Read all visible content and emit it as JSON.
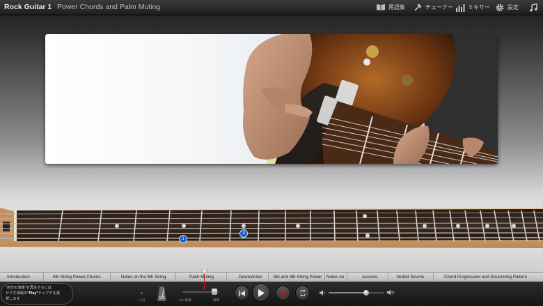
{
  "app": {
    "title": "Rock Guitar 1",
    "lesson": "Power Chords and Palm Muting"
  },
  "toolbar": {
    "glossary": "用語集",
    "tuner": "チューナー",
    "mixer": "ミキサー",
    "settings": "設定"
  },
  "chapters": [
    "Introduction",
    "6th String Power Chords",
    "Notes on the 6th String",
    "Palm Muting",
    "Downstroke",
    "5th and 4th String Power",
    "Notes on",
    "Accents",
    "Muted Strums",
    "Chord Progression and Strumming Pattern"
  ],
  "fretboard": {
    "finger_markers": [
      "1",
      "3"
    ]
  },
  "hint": {
    "line1": "\"自分の演奏\"を再生するには",
    "line2_pre": "ビデオ領域の",
    "line2_bold": "\"Play\"",
    "line2_post": "チャプタを選",
    "line3": "択します"
  },
  "controls": {
    "input_label": "入力",
    "tempo_value": "119",
    "speed_label": "1/2 再演",
    "normal_label": "標準"
  },
  "colors": {
    "playhead": "#d62020",
    "finger_marker": "#1f5fbf"
  }
}
